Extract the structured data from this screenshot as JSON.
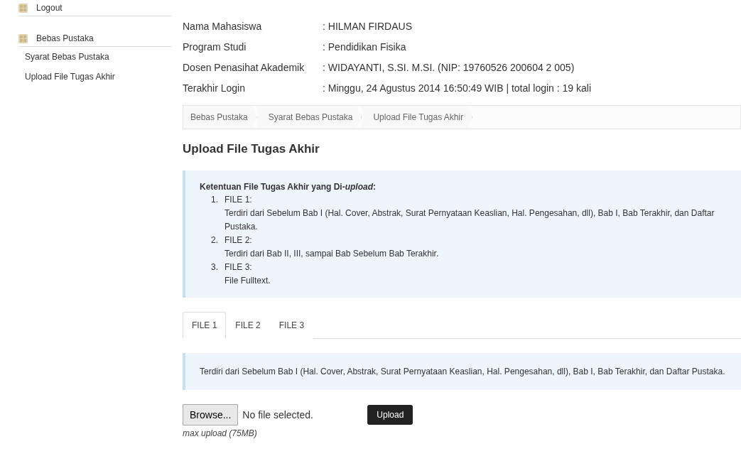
{
  "sidebar": {
    "items": [
      {
        "label": "Logout",
        "kind": "header"
      },
      {
        "label": "Bebas Pustaka",
        "kind": "header",
        "children": [
          {
            "label": "Syarat Bebas Pustaka"
          },
          {
            "label": "Upload File Tugas Akhir"
          }
        ]
      }
    ]
  },
  "profile": [
    {
      "label": "Nama Mahasiswa",
      "value": ": HILMAN FIRDAUS"
    },
    {
      "label": "Program Studi",
      "value": ": Pendidikan Fisika"
    },
    {
      "label": "Dosen Penasihat Akademik",
      "value": ": WIDAYANTI, S.SI. M.SI. (NIP: 19760526 200604 2 005)"
    },
    {
      "label": "Terakhir Login",
      "value": ": Minggu, 24 Agustus 2014 16:50:49 WIB | total login : 19 kali"
    }
  ],
  "breadcrumb": [
    "Bebas Pustaka",
    "Syarat Bebas Pustaka",
    "Upload File Tugas Akhir"
  ],
  "heading": "Upload File Tugas Akhir",
  "rules": {
    "title": "Ketentuan File Tugas Akhir yang Di-*upload*:",
    "items": [
      {
        "marker": "1.",
        "title": "FILE 1:",
        "text": "Terdiri dari Sebelum Bab I (Hal. Cover, Abstrak, Surat Pernyataan Keaslian, Hal. Pengesahan, dll), Bab I, Bab Terakhir, dan Daftar Pustaka."
      },
      {
        "marker": "2.",
        "title": "FILE 2:",
        "text": "Terdiri dari Bab II, III, sampai Bab Sebelum Bab Terakhir."
      },
      {
        "marker": "3.",
        "title": "FILE 3:",
        "text": "File Fulltext."
      }
    ]
  },
  "tabs": [
    {
      "label": "FILE 1",
      "selected": true
    },
    {
      "label": "FILE 2",
      "selected": false
    },
    {
      "label": "FILE 3",
      "selected": false
    }
  ],
  "tab_description": "Terdiri dari Sebelum Bab I (Hal. Cover, Abstrak, Surat Pernyataan Keaslian, Hal. Pengesahan, dll), Bab I, Bab Terakhir, dan Daftar Pustaka.",
  "upload": {
    "browse": "Browse...",
    "status": "No file selected.",
    "button": "Upload",
    "note": "max upload (75MB)"
  }
}
